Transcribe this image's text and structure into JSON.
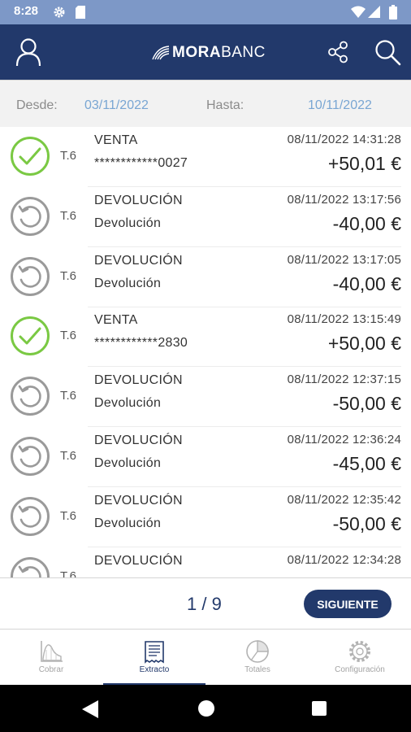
{
  "status_bar": {
    "time": "8:28",
    "icons": [
      "gear-icon",
      "sd-card-icon",
      "wifi-icon",
      "signal-icon",
      "battery-icon"
    ]
  },
  "header": {
    "logo_bold": "MORA",
    "logo_light": "BANC",
    "icons": [
      "user-icon",
      "share-icon",
      "search-icon"
    ]
  },
  "filter": {
    "from_label": "Desde:",
    "from_value": "03/11/2022",
    "to_label": "Hasta:",
    "to_value": "10/11/2022"
  },
  "transactions": [
    {
      "status": "approved",
      "terminal": "T.6",
      "type": "VENTA",
      "detail": "************0027",
      "datetime": "08/11/2022 14:31:28",
      "amount": "+50,01 €"
    },
    {
      "status": "refund",
      "terminal": "T.6",
      "type": "DEVOLUCIÓN",
      "detail": "Devolución",
      "datetime": "08/11/2022 13:17:56",
      "amount": "-40,00 €"
    },
    {
      "status": "refund",
      "terminal": "T.6",
      "type": "DEVOLUCIÓN",
      "detail": "Devolución",
      "datetime": "08/11/2022 13:17:05",
      "amount": "-40,00 €"
    },
    {
      "status": "approved",
      "terminal": "T.6",
      "type": "VENTA",
      "detail": "************2830",
      "datetime": "08/11/2022 13:15:49",
      "amount": "+50,00 €"
    },
    {
      "status": "refund",
      "terminal": "T.6",
      "type": "DEVOLUCIÓN",
      "detail": "Devolución",
      "datetime": "08/11/2022 12:37:15",
      "amount": "-50,00 €"
    },
    {
      "status": "refund",
      "terminal": "T.6",
      "type": "DEVOLUCIÓN",
      "detail": "Devolución",
      "datetime": "08/11/2022 12:36:24",
      "amount": "-45,00 €"
    },
    {
      "status": "refund",
      "terminal": "T.6",
      "type": "DEVOLUCIÓN",
      "detail": "Devolución",
      "datetime": "08/11/2022 12:35:42",
      "amount": "-50,00 €"
    },
    {
      "status": "refund",
      "terminal": "T.6",
      "type": "DEVOLUCIÓN",
      "detail": "",
      "datetime": "08/11/2022 12:34:28",
      "amount": ""
    }
  ],
  "pagination": {
    "pages": "1 / 9",
    "next_label": "SIGUIENTE"
  },
  "bottom_nav": {
    "items": [
      {
        "label": "Cobrar",
        "icon": "chart-icon"
      },
      {
        "label": "Extracto",
        "icon": "receipt-icon"
      },
      {
        "label": "Totales",
        "icon": "pie-chart-icon"
      },
      {
        "label": "Configuración",
        "icon": "gear-icon"
      }
    ],
    "active": "Extracto"
  },
  "colors": {
    "status_bar": "#7d98c7",
    "primary": "#22396b",
    "date_value": "#79a6d3",
    "approved": "#7ac943",
    "refund": "#9a9a9a"
  }
}
